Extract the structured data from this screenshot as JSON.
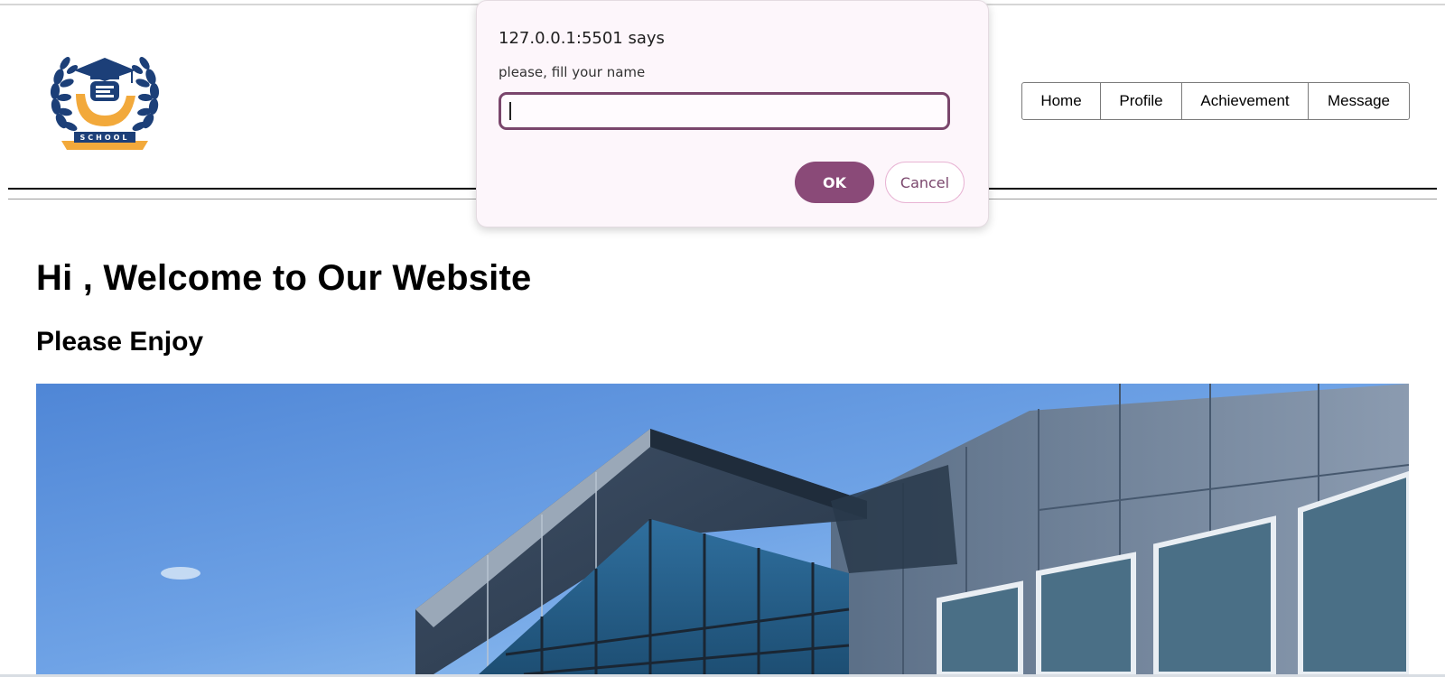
{
  "logo": {
    "text": "SCHOOL",
    "colors": {
      "navy": "#1c3f78",
      "gold": "#f2a93b"
    }
  },
  "nav": {
    "items": [
      {
        "label": "Home"
      },
      {
        "label": "Profile"
      },
      {
        "label": "Achievement"
      },
      {
        "label": "Message"
      }
    ]
  },
  "main": {
    "welcome_heading": "Hi , Welcome to Our Website",
    "subheading": "Please Enjoy",
    "hero_image": "school-building-photo"
  },
  "dialog": {
    "title": "127.0.0.1:5501 says",
    "message": "please, fill your name",
    "input_value": "",
    "ok_label": "OK",
    "cancel_label": "Cancel",
    "accent_color": "#8a4a78"
  }
}
